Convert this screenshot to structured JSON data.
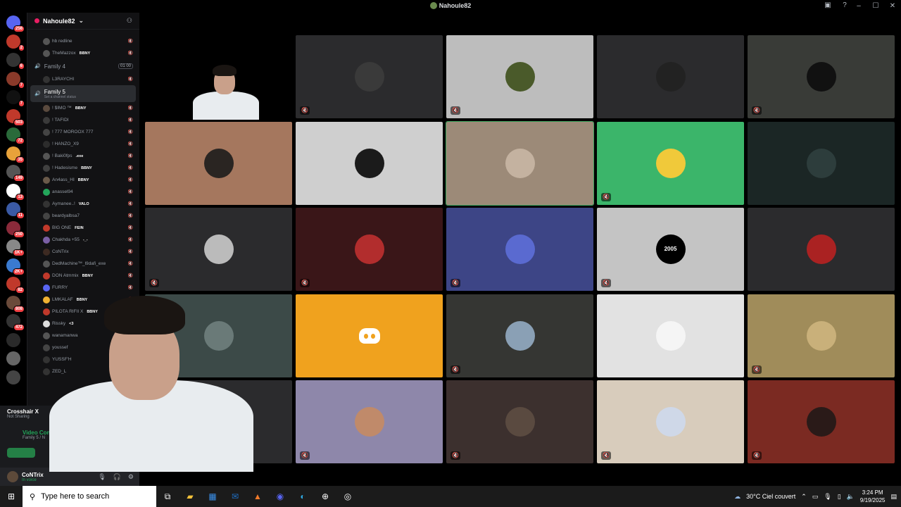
{
  "window": {
    "title": "Nahoule82"
  },
  "rail": {
    "badges": [
      "256",
      "2",
      "6",
      "7",
      "7",
      "503",
      "72",
      "35",
      "149",
      "13",
      "11",
      "250",
      "1K+",
      "2K+",
      "82",
      "808",
      "472"
    ]
  },
  "sidebar": {
    "server_name": "Nahoule82",
    "rows_top": [
      {
        "name": "hb redline",
        "tag": ""
      },
      {
        "name": "TheMazzox",
        "tag": "BBNY"
      }
    ],
    "channel4": {
      "label": "Family 4",
      "count": "01 00"
    },
    "channel4_users": [
      {
        "name": "L3RAYCHI",
        "tag": ""
      }
    ],
    "channel5": {
      "label": "Family 5",
      "status": "Set a channel status"
    },
    "members": [
      {
        "name": "! $IMO ™",
        "tag": "BBNY",
        "color": "#5a4a3e"
      },
      {
        "name": "! TAFIDI",
        "tag": "",
        "color": "#3a3a3a"
      },
      {
        "name": "! 777 MOROOX 777",
        "tag": "",
        "color": "#444"
      },
      {
        "name": "! HANZO_X9",
        "tag": "",
        "color": "#2c2c2c"
      },
      {
        "name": "! Baki0fps",
        "tag": ".exe",
        "color": "#555"
      },
      {
        "name": "! Hadesisme",
        "tag": "BBNY",
        "color": "#404040"
      },
      {
        "name": "An4ass_HI",
        "tag": "BBNY",
        "color": "#6a5a4a"
      },
      {
        "name": "anassel94",
        "tag": "",
        "color": "#23a55a"
      },
      {
        "name": "Aymanee..!",
        "tag": "VALO",
        "color": "#333"
      },
      {
        "name": "beardyalbsa7",
        "tag": "",
        "color": "#444"
      },
      {
        "name": "BIG ONE",
        "tag": "FEIN",
        "color": "#c0392b"
      },
      {
        "name": "Chakhda +55",
        "tag": "-_-",
        "color": "#7a5fa5"
      },
      {
        "name": "CoNTrix",
        "tag": "",
        "color": "#3d2a22"
      },
      {
        "name": "DedMachine™_l9dafi_exe",
        "tag": "",
        "color": "#555"
      },
      {
        "name": "DON Atmmix",
        "tag": "BBNY",
        "color": "#c0392b"
      },
      {
        "name": "FURRY",
        "tag": "",
        "color": "#5865f2"
      },
      {
        "name": "LMKALAF",
        "tag": "BBNY",
        "color": "#f0b232"
      },
      {
        "name": "PILOTA RIFII X",
        "tag": "BBNY",
        "color": "#c0392b"
      },
      {
        "name": "Rissky",
        "tag": "<3",
        "color": "#ddd"
      },
      {
        "name": "wanamanwa",
        "tag": "",
        "color": "#555"
      },
      {
        "name": "youssef",
        "tag": "",
        "color": "#444"
      },
      {
        "name": "YUSSF'H",
        "tag": "",
        "color": "#333"
      },
      {
        "name": "ZED_L",
        "tag": "",
        "color": "#333"
      }
    ]
  },
  "voice_panel": {
    "activity_title": "Crosshair X",
    "activity_sub": "Not Sharing",
    "connection_title": "Video Con",
    "connection_sub": "Family 5 / N",
    "user_name": "CoNTrix",
    "user_status": "In voice"
  },
  "grid": {
    "tiles": [
      {
        "bg": "#2b2b2d",
        "avatar": "#3a3a3a",
        "muted": true,
        "speaking": false
      },
      {
        "bg": "#bdbdbd",
        "avatar": "#4a5a2a",
        "muted": true,
        "speaking": false
      },
      {
        "bg": "#2b2b2d",
        "avatar": "#222",
        "muted": false,
        "speaking": false
      },
      {
        "bg": "#393b37",
        "avatar": "#111",
        "muted": true,
        "speaking": false
      },
      {
        "bg": "#a5775e",
        "avatar": "#2a2522",
        "muted": false,
        "speaking": false
      },
      {
        "bg": "#cfcfcf",
        "avatar": "#1b1b1b",
        "muted": false,
        "speaking": false
      },
      {
        "bg": "#9c8a78",
        "avatar": "#c4b2a0",
        "muted": false,
        "speaking": true
      },
      {
        "bg": "#3bb56a",
        "avatar": "#f0c93a",
        "muted": true,
        "speaking": false
      },
      {
        "bg": "#1b2625",
        "avatar": "#2d3d3c",
        "muted": false,
        "speaking": false
      },
      {
        "bg": "#2b2b2d",
        "avatar": "#bbb",
        "muted": true,
        "speaking": false
      },
      {
        "bg": "#3a1618",
        "avatar": "#b22d2d",
        "muted": true,
        "speaking": false
      },
      {
        "bg": "#3d4586",
        "avatar": "#5a6ad0",
        "muted": true,
        "speaking": false
      },
      {
        "bg": "#c4c4c4",
        "avatar": "#000",
        "muted": true,
        "speaking": false,
        "label": "2005"
      },
      {
        "bg": "#2b2b2d",
        "avatar": "#a22",
        "muted": false,
        "speaking": false
      },
      {
        "bg": "#3c4a48",
        "avatar": "#6a7a78",
        "muted": false,
        "speaking": false
      },
      {
        "bg": "#f0a21e",
        "avatar": "",
        "muted": false,
        "speaking": false,
        "discord": true
      },
      {
        "bg": "#353633",
        "avatar": "#8aa0b5",
        "muted": true,
        "speaking": false
      },
      {
        "bg": "#e2e2e2",
        "avatar": "#f5f5f5",
        "muted": false,
        "speaking": false
      },
      {
        "bg": "#a08c5a",
        "avatar": "#c9b07a",
        "muted": true,
        "speaking": false
      },
      {
        "bg": "#2b2b2d",
        "avatar": "#555",
        "muted": false,
        "speaking": false
      },
      {
        "bg": "#8e87aa",
        "avatar": "#c08a6a",
        "muted": true,
        "speaking": false
      },
      {
        "bg": "#3c302e",
        "avatar": "#5a4a40",
        "muted": true,
        "speaking": false
      },
      {
        "bg": "#d8ccbc",
        "avatar": "#cfd8e8",
        "muted": true,
        "speaking": false
      },
      {
        "bg": "#7b2a22",
        "avatar": "#2a1a18",
        "muted": true,
        "speaking": false
      }
    ]
  },
  "taskbar": {
    "search_placeholder": "Type here to search",
    "weather": "30°C Ciel couvert",
    "time": "3:24 PM",
    "date": "9/19/2025"
  }
}
